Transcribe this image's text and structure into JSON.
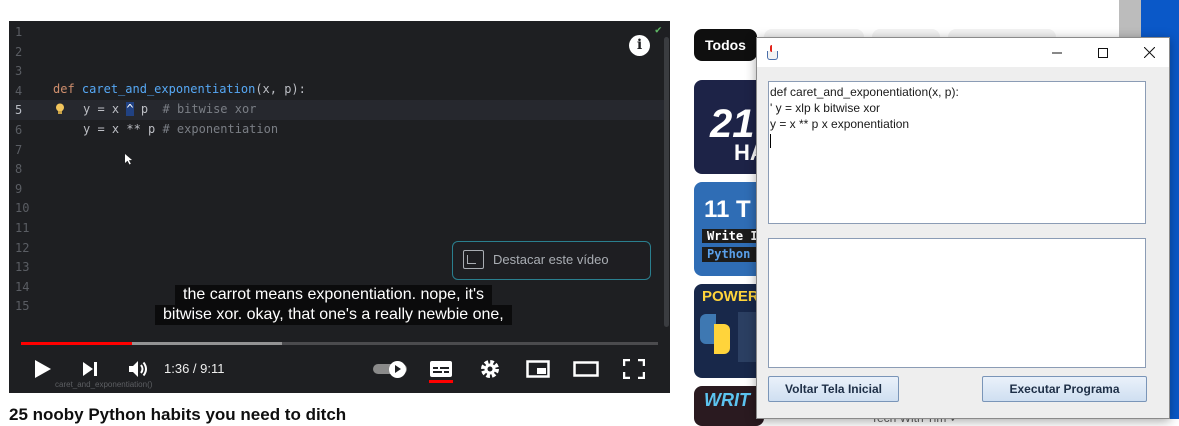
{
  "player": {
    "editor_lines": [
      {
        "num": "1",
        "code": ""
      },
      {
        "num": "2",
        "code": ""
      },
      {
        "num": "3",
        "code": ""
      },
      {
        "num": "4",
        "code": "def caret_and_exponentiation(x, p):"
      },
      {
        "num": "5",
        "code": "y = x ^ p  # bitwise xor"
      },
      {
        "num": "6",
        "code": "y = x ** p # exponentiation"
      },
      {
        "num": "7",
        "code": ""
      },
      {
        "num": "8",
        "code": ""
      },
      {
        "num": "9",
        "code": ""
      },
      {
        "num": "10",
        "code": ""
      },
      {
        "num": "11",
        "code": ""
      },
      {
        "num": "12",
        "code": ""
      },
      {
        "num": "13",
        "code": ""
      },
      {
        "num": "14",
        "code": ""
      },
      {
        "num": "15",
        "code": ""
      }
    ],
    "code": {
      "def_kw": "def",
      "func_name": "caret_and_exponentiation",
      "params": "(x, p):",
      "line5_pre": "y = x ",
      "line5_caret": "^",
      "line5_post": " p  ",
      "line5_comment": "# bitwise xor",
      "line6_code": "y = x ** p ",
      "line6_comment": "# exponentiation"
    },
    "pip_tooltip": "Destacar este vídeo",
    "subtitle_line1": "the carrot means exponentiation. nope, it's",
    "subtitle_line2": "bitwise xor. okay, that one's a really newbie one,",
    "chapter_label": "caret_and_exponentiation()",
    "time_display": "1:36 / 9:11",
    "progress_played_fraction": 0.174,
    "progress_buffered_fraction": 0.41,
    "icons": [
      "info-icon",
      "play-icon",
      "next-icon",
      "volume-icon",
      "autoplay-toggle",
      "captions-icon",
      "settings-icon",
      "miniplayer-icon",
      "theater-icon",
      "fullscreen-icon"
    ]
  },
  "video_title": "25 nooby Python habits you need to ditch",
  "sidebar": {
    "chip_active": "Todos",
    "thumbnails": [
      {
        "text_main": "21",
        "text_sub": "HA"
      },
      {
        "text_main": "11 T",
        "badge1": "Write I",
        "badge2": "Python"
      },
      {
        "text_main": "POWER"
      },
      {
        "text_main": "WRIT"
      }
    ],
    "channel_partial": "Tech With Tim ✓"
  },
  "java_window": {
    "titlebar_buttons": [
      "minimize",
      "maximize",
      "close"
    ],
    "input_text": "def caret_and_exponentiation(x, p):\n' y = xlp k bitwise xor\ny = x ** p x exponentiation\n",
    "output_text": "",
    "button_back": "Voltar Tela Inicial",
    "button_run": "Executar Programa"
  },
  "colors": {
    "editor_bg": "#1e1f22",
    "progress_red": "#ff0000",
    "keyword": "#cf8e6d",
    "function": "#56a8f5",
    "comment": "#7a7e85",
    "taskbar_blue": "#0a58c8"
  }
}
